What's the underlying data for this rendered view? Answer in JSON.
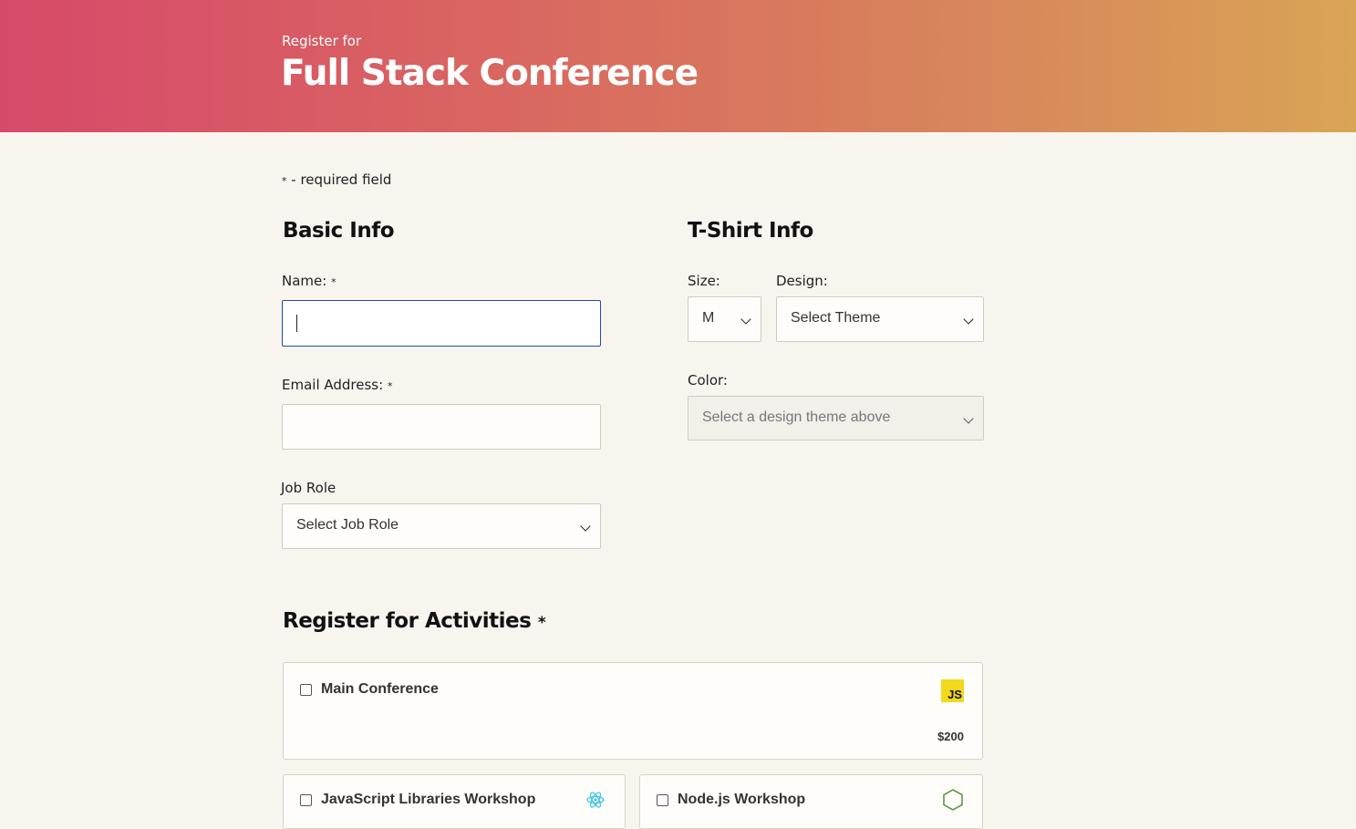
{
  "header": {
    "subtitle": "Register for",
    "title": "Full Stack Conference"
  },
  "required_note": {
    "star": "*",
    "text": " - required field"
  },
  "basic_info": {
    "heading": "Basic Info",
    "name_label": "Name:",
    "name_value": "",
    "email_label": "Email Address:",
    "email_value": "",
    "job_role_label": "Job Role",
    "job_role_selected": "Select Job Role",
    "required_star": "*"
  },
  "tshirt_info": {
    "heading": "T-Shirt Info",
    "size_label": "Size:",
    "size_selected": "M",
    "design_label": "Design:",
    "design_selected": "Select Theme",
    "color_label": "Color:",
    "color_selected": "Select a design theme above"
  },
  "activities": {
    "heading": "Register for Activities",
    "required_star": "*",
    "items": [
      {
        "title": "Main Conference",
        "price": "$200",
        "icon": "js-icon",
        "checked": false
      },
      {
        "title": "JavaScript Libraries Workshop",
        "icon": "react-icon",
        "checked": false
      },
      {
        "title": "Node.js Workshop",
        "icon": "nodejs-icon",
        "checked": false
      }
    ]
  },
  "colors": {
    "header_gradient_start": "#d7496a",
    "header_gradient_end": "#d9a455",
    "page_background": "#f8f5ef",
    "focus_border": "#1f4aa8",
    "js_badge": "#f3d81c"
  }
}
